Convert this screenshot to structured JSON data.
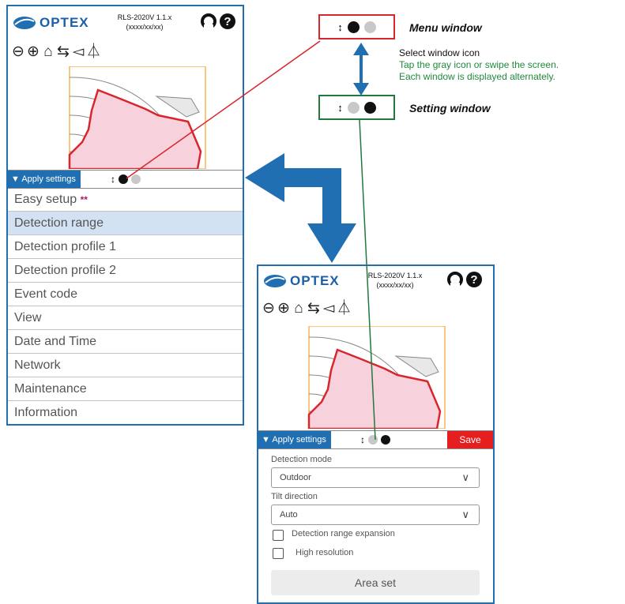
{
  "brand": {
    "logo_text": "OPTEX",
    "accent": "#1f6fb2"
  },
  "device": {
    "model": "RLS-2020V 1.1.x",
    "date": "(xxxx/xx/xx)"
  },
  "header_icons": [
    "rotate-icon",
    "help-icon"
  ],
  "toolbar": {
    "zoom_out": "⊖",
    "zoom_in": "⊕",
    "home": "⌂",
    "swap": "⇆",
    "flip_left": "◅",
    "mirror": "⏃"
  },
  "bar": {
    "apply_label": "▼ Apply settings",
    "switch_glyph": "↕",
    "save_label": "Save"
  },
  "menu_window": {
    "items": [
      {
        "label": "Easy setup",
        "badge": "**"
      },
      {
        "label": "Detection range",
        "selected": true
      },
      {
        "label": "Detection profile 1"
      },
      {
        "label": "Detection profile 2"
      },
      {
        "label": "Event code"
      },
      {
        "label": "View"
      },
      {
        "label": "Date and Time"
      },
      {
        "label": "Network"
      },
      {
        "label": "Maintenance"
      },
      {
        "label": "Information"
      }
    ]
  },
  "setting_window": {
    "detection_mode_label": "Detection mode",
    "detection_mode_value": "Outdoor",
    "tilt_label": "Tilt direction",
    "tilt_value": "Auto",
    "chevron": "∨",
    "range_expansion_label": "Detection range expansion",
    "high_res_label": "High resolution",
    "area_set_label": "Area set"
  },
  "callouts": {
    "menu_window_label": "Menu window",
    "setting_window_label": "Setting window",
    "note_line1": "Select window icon",
    "note_line2": "Tap the gray icon or swipe the screen.",
    "note_line3": "Each window is displayed alternately."
  },
  "colors": {
    "menu_callout": "#d7262c",
    "setting_callout": "#1f7a3c",
    "note_green": "#1f8a3a",
    "area_fill": "#f7d2dc",
    "area_edge": "#d7262c",
    "frame": "#f2a32a"
  }
}
